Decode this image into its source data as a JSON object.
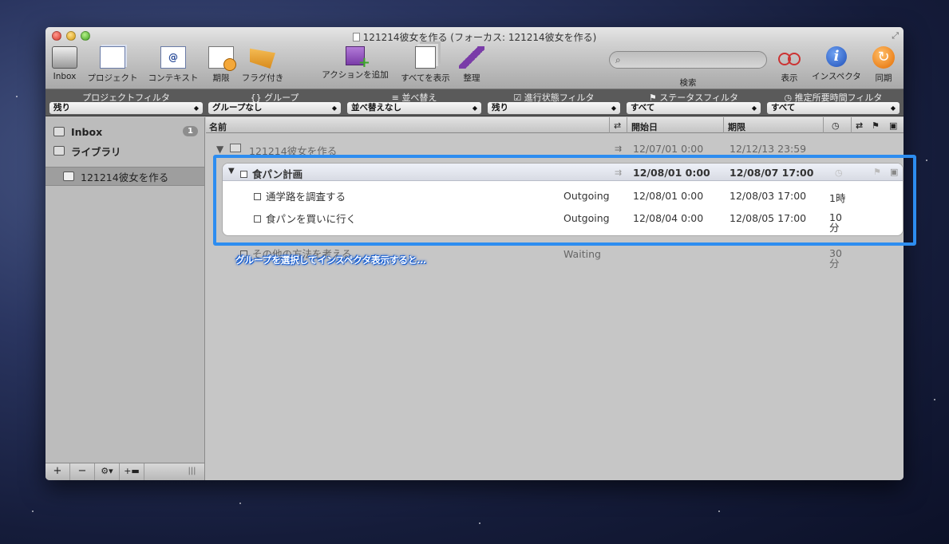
{
  "window": {
    "title": "121214彼女を作る (フォーカス: 121214彼女を作る)"
  },
  "toolbar": {
    "inbox": "Inbox",
    "project": "プロジェクト",
    "context": "コンテキスト",
    "due": "期限",
    "flagged": "フラグ付き",
    "add_action": "アクションを追加",
    "show_all": "すべてを表示",
    "clean_up": "整理",
    "search_label": "検索",
    "view": "表示",
    "inspector": "インスペクタ",
    "sync": "同期",
    "context_icon_glyph": "@"
  },
  "filters": {
    "project": {
      "label": "プロジェクトフィルタ",
      "value": "残り"
    },
    "group": {
      "label": "{} グループ",
      "value": "グループなし"
    },
    "sort": {
      "label": "並べ替え",
      "value": "並べ替えなし"
    },
    "progress": {
      "label": "進行状態フィルタ",
      "value": "残り"
    },
    "status": {
      "label": "ステータスフィルタ",
      "value": "すべて"
    },
    "duration": {
      "label": "推定所要時間フィルタ",
      "value": "すべて"
    }
  },
  "sidebar": {
    "inbox": {
      "label": "Inbox",
      "badge": "1"
    },
    "library": {
      "label": "ライブラリ"
    },
    "selected_project": {
      "label": "121214彼女を作る"
    }
  },
  "columns": {
    "name": "名前",
    "start": "開始日",
    "due": "期限"
  },
  "rows": {
    "project": {
      "name": "121214彼女を作る",
      "start": "12/07/01 0:00",
      "due": "12/12/13 23:59"
    },
    "group": {
      "name": "食パン計画",
      "start": "12/08/01 0:00",
      "due": "12/08/07 17:00"
    },
    "task1": {
      "name": "通学路を調査する",
      "context": "Outgoing",
      "start": "12/08/01 0:00",
      "due": "12/08/03 17:00",
      "duration": "1時"
    },
    "task2": {
      "name": "食パンを買いに行く",
      "context": "Outgoing",
      "start": "12/08/04 0:00",
      "due": "12/08/05 17:00",
      "duration_line1": "10",
      "duration_line2": "分"
    },
    "task3": {
      "name": "その他の方法を考える",
      "context": "Waiting",
      "duration_line1": "30",
      "duration_line2": "分"
    }
  },
  "caption": "グループを選択してインスペクタ表示すると…",
  "colors": {
    "focus_frame": "#2d8df0",
    "caption_outline": "#1a5fd0"
  }
}
